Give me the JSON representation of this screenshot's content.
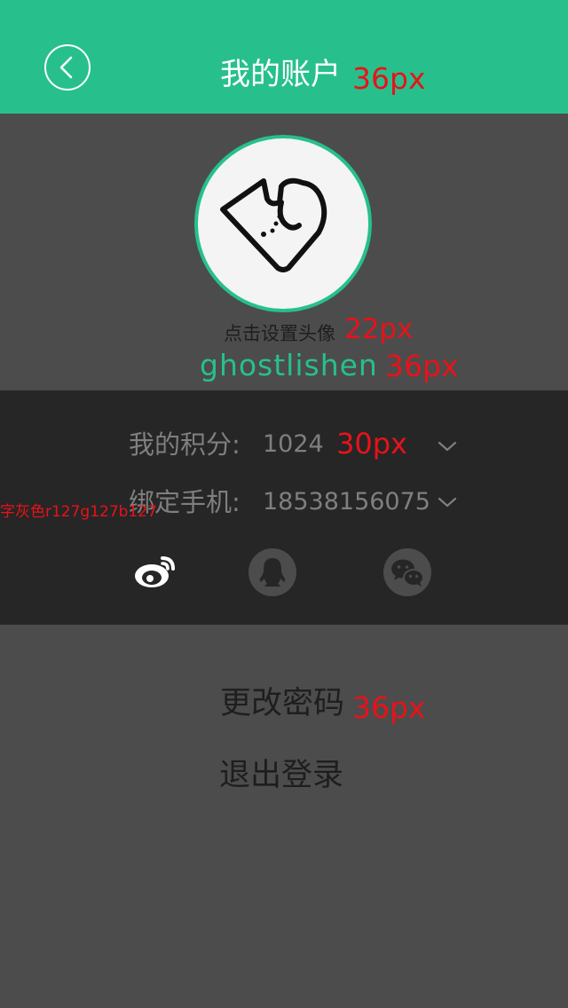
{
  "header": {
    "title": "我的账户",
    "title_anno": "36px",
    "back_icon": "chevron-left-circle-icon",
    "bg_color": "#27c08c"
  },
  "profile": {
    "avatar_icon": "cat-heart-icon",
    "set_avatar_label": "点击设置头像",
    "set_avatar_anno": "22px",
    "username": "ghostlishen",
    "username_anno": "36px",
    "accent_color": "#27c08c"
  },
  "info": {
    "points_label": "我的积分:",
    "points_value": "1024",
    "points_anno": "30px",
    "phone_label": "绑定手机:",
    "phone_value": "18538156075",
    "text_color_anno": "字灰色r127g127b127",
    "social_icons": [
      "weibo-icon",
      "qq-icon",
      "wechat-icon"
    ]
  },
  "menu": {
    "change_password": "更改密码",
    "change_password_anno": "36px",
    "logout": "退出登录"
  }
}
